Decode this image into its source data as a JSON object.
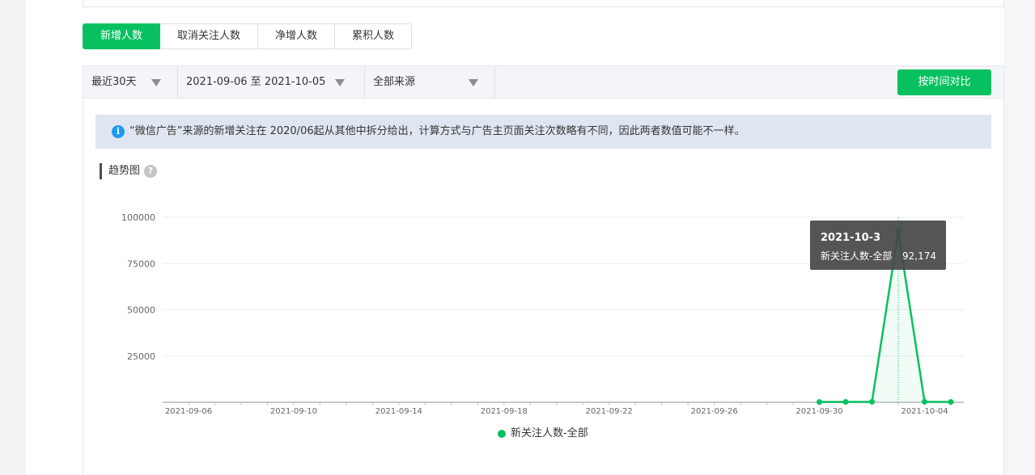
{
  "tabs": [
    {
      "label": "新增人数",
      "active": true
    },
    {
      "label": "取消关注人数",
      "active": false
    },
    {
      "label": "净增人数",
      "active": false
    },
    {
      "label": "累积人数",
      "active": false
    }
  ],
  "filters": {
    "range": "最近30天",
    "dates": "2021-09-06 至 2021-10-05",
    "source": "全部来源"
  },
  "compare_button": "按时间对比",
  "notice": "“微信广告”来源的新增关注在 2020/06起从其他中拆分给出，计算方式与广告主页面关注次数略有不同，因此两者数值可能不一样。",
  "section_title": "趋势图",
  "help_symbol": "?",
  "info_symbol": "i",
  "tooltip": {
    "date": "2021-10-3",
    "label": "新关注人数-全部",
    "value": "92,174"
  },
  "colors": {
    "accent": "#07c160",
    "notice_bg": "#dfe6f1",
    "tooltip_bg": "#464646"
  },
  "chart_data": {
    "type": "line",
    "title": "",
    "x": [
      "2021-09-06",
      "2021-09-07",
      "2021-09-08",
      "2021-09-09",
      "2021-09-10",
      "2021-09-11",
      "2021-09-12",
      "2021-09-13",
      "2021-09-14",
      "2021-09-15",
      "2021-09-16",
      "2021-09-17",
      "2021-09-18",
      "2021-09-19",
      "2021-09-20",
      "2021-09-21",
      "2021-09-22",
      "2021-09-23",
      "2021-09-24",
      "2021-09-25",
      "2021-09-26",
      "2021-09-27",
      "2021-09-28",
      "2021-09-29",
      "2021-09-30",
      "2021-10-01",
      "2021-10-02",
      "2021-10-03",
      "2021-10-04",
      "2021-10-05"
    ],
    "xtick_labels": [
      "2021-09-06",
      "2021-09-10",
      "2021-09-14",
      "2021-09-18",
      "2021-09-22",
      "2021-09-26",
      "2021-09-30",
      "2021-10-04"
    ],
    "yticks": [
      25000,
      50000,
      75000,
      100000
    ],
    "ylim": [
      0,
      100000
    ],
    "grid": true,
    "legend_position": "bottom",
    "series": [
      {
        "name": "新关注人数-全部",
        "color": "#07c160",
        "values": [
          null,
          null,
          null,
          null,
          null,
          null,
          null,
          null,
          null,
          null,
          null,
          null,
          null,
          null,
          null,
          null,
          null,
          null,
          null,
          null,
          null,
          null,
          null,
          null,
          150,
          200,
          300,
          92174,
          300,
          200
        ]
      }
    ]
  }
}
